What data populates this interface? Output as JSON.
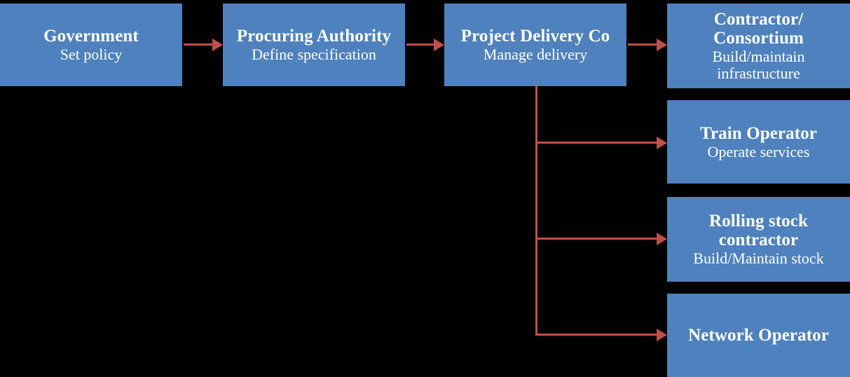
{
  "diagram": {
    "background_color": "#000000",
    "node_color": "#4e81bd",
    "node_text_color": "#ffffff",
    "connector_color": "#c0504d",
    "nodes": [
      {
        "id": "government",
        "title": "Government",
        "subtitle": "Set policy"
      },
      {
        "id": "procuring",
        "title": "Procuring Authority",
        "subtitle": "Define specification"
      },
      {
        "id": "project-co",
        "title": "Project Delivery Co",
        "subtitle": "Manage delivery"
      },
      {
        "id": "contractor",
        "title": "Contractor/ Consortium",
        "subtitle": "Build/maintain infrastructure"
      },
      {
        "id": "train-operator",
        "title": "Train Operator",
        "subtitle": "Operate services"
      },
      {
        "id": "rolling-stock",
        "title": "Rolling stock contractor",
        "subtitle": "Build/Maintain stock"
      },
      {
        "id": "network-operator",
        "title": "Network Operator",
        "subtitle": ""
      }
    ],
    "connectors": [
      {
        "id": "gov-to-proc",
        "from": "government",
        "to": "procuring",
        "style": "arrow"
      },
      {
        "id": "proc-to-pdc",
        "from": "procuring",
        "to": "project-co",
        "style": "arrow"
      },
      {
        "id": "pdc-to-contr",
        "from": "project-co",
        "to": "contractor",
        "style": "arrow"
      },
      {
        "id": "pdc-to-train",
        "from": "project-co",
        "to": "train-operator",
        "style": "elbow-arrow"
      },
      {
        "id": "pdc-to-rolling",
        "from": "project-co",
        "to": "rolling-stock",
        "style": "elbow-arrow"
      },
      {
        "id": "pdc-to-network",
        "from": "project-co",
        "to": "network-operator",
        "style": "elbow-arrow"
      }
    ]
  }
}
